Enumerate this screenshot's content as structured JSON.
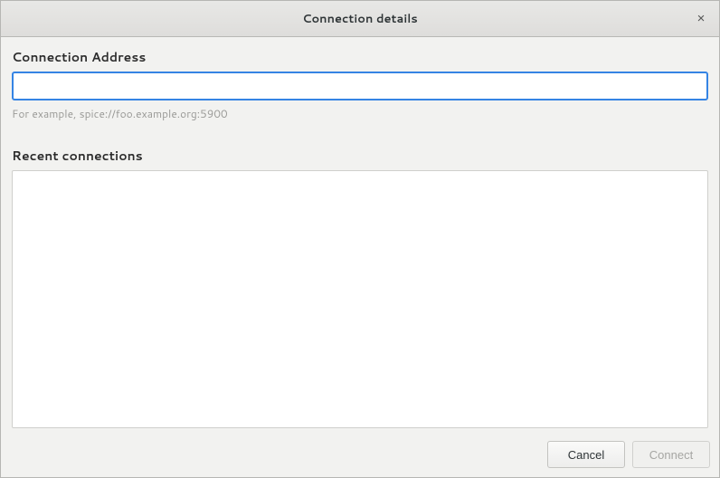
{
  "window": {
    "title": "Connection details",
    "close_icon": "×"
  },
  "address": {
    "label": "Connection Address",
    "value": "",
    "hint": "For example, spice://foo.example.org:5900"
  },
  "recent": {
    "label": "Recent connections"
  },
  "buttons": {
    "cancel": "Cancel",
    "connect": "Connect"
  }
}
